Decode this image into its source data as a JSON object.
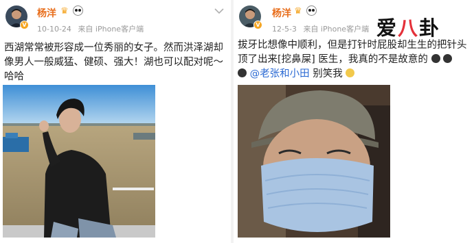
{
  "left_post": {
    "username": "杨洋",
    "timestamp": "10-10-24",
    "source": "来自 iPhone客户端",
    "text": "西湖常常被形容成一位秀丽的女子。然而洪泽湖却像男人一般威猛、健硕、强大！湖也可以配对呢～哈哈"
  },
  "right_post": {
    "username": "杨洋",
    "timestamp": "12-5-3",
    "source": "来自 iPhone客户端",
    "text": "拔牙比想像中顺利，但是打针时屁股却生生的把针头顶了出来[挖鼻屎] 医生，我真的不是故意的",
    "mention": "@老张和小田",
    "tail": "别笑我"
  },
  "watermark": {
    "text_left": "爱",
    "text_right": "卦",
    "accent_color": "#e4313a"
  },
  "colors": {
    "username": "#e86e1c",
    "mention": "#2b6ad3",
    "meta": "#999999"
  },
  "icons": [
    "crown-icon",
    "panda-icon",
    "chevron-down-icon",
    "verified-badge"
  ]
}
